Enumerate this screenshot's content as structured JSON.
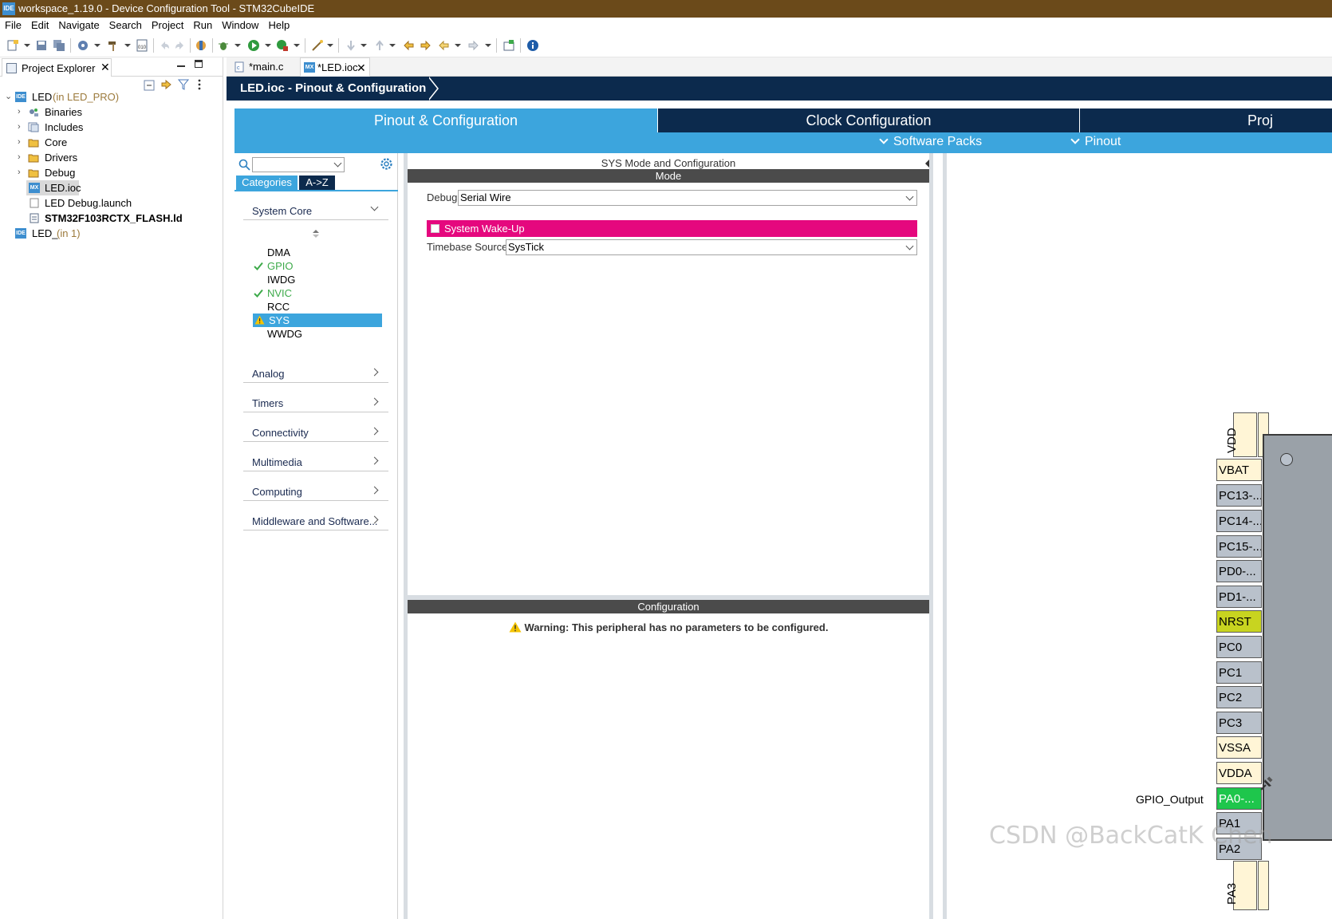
{
  "window": {
    "title": "workspace_1.19.0 - Device Configuration Tool - STM32CubeIDE",
    "icon_label": "IDE"
  },
  "menu": [
    "File",
    "Edit",
    "Navigate",
    "Search",
    "Project",
    "Run",
    "Window",
    "Help"
  ],
  "project_explorer": {
    "tab_label": "Project Explorer",
    "tree": [
      {
        "label": "LED",
        "suffix": "(in LED_PRO)"
      },
      {
        "label": "Binaries"
      },
      {
        "label": "Includes"
      },
      {
        "label": "Core"
      },
      {
        "label": "Drivers"
      },
      {
        "label": "Debug"
      },
      {
        "label": "LED.ioc"
      },
      {
        "label": "LED Debug.launch"
      },
      {
        "label": "STM32F103RCTX_FLASH.ld"
      },
      {
        "label": "LED_",
        "suffix": "(in 1)"
      }
    ]
  },
  "editor_tabs": [
    {
      "label": "*main.c"
    },
    {
      "label": "*LED.ioc",
      "icon_label": "MX"
    }
  ],
  "breadcrumb": "LED.ioc - Pinout & Configuration",
  "main_tabs": [
    "Pinout & Configuration",
    "Clock Configuration",
    "Proj"
  ],
  "sub_menus": [
    "Software Packs",
    "Pinout"
  ],
  "categories": {
    "tab_categories": "Categories",
    "tab_az": "A->Z",
    "system_core": "System Core",
    "items": [
      "DMA",
      "GPIO",
      "IWDG",
      "NVIC",
      "RCC",
      "SYS",
      "WWDG"
    ],
    "groups": [
      "Analog",
      "Timers",
      "Connectivity",
      "Multimedia",
      "Computing",
      "Middleware and Software..."
    ]
  },
  "sys_panel": {
    "title": "SYS Mode and Configuration",
    "mode_header": "Mode",
    "debug_label": "Debug",
    "debug_value": "Serial Wire",
    "wakeup_label": "System Wake-Up",
    "timebase_label": "Timebase Source",
    "timebase_value": "SysTick",
    "config_header": "Configuration",
    "warning": "Warning: This peripheral has no parameters to be configured."
  },
  "chip": {
    "left_pins": [
      "VBAT",
      "PC13-...",
      "PC14-...",
      "PC15-...",
      "PD0-...",
      "PD1-...",
      "NRST",
      "PC0",
      "PC1",
      "PC2",
      "PC3",
      "VSSA",
      "VDDA",
      "PA0-...",
      "PA1",
      "PA2"
    ],
    "top_pins": [
      "VDD"
    ],
    "bottom_pins": [
      "PA3"
    ],
    "gpio_label": "GPIO_Output"
  },
  "watermark": "CSDN @BackCatK Chen",
  "colors": {
    "accent": "#3ca5dd",
    "navy": "#0c2a4d",
    "wakeup": "#e5087e",
    "ok": "#3daa4a",
    "nrst": "#c8d420",
    "gpio_out": "#1ec64c"
  }
}
